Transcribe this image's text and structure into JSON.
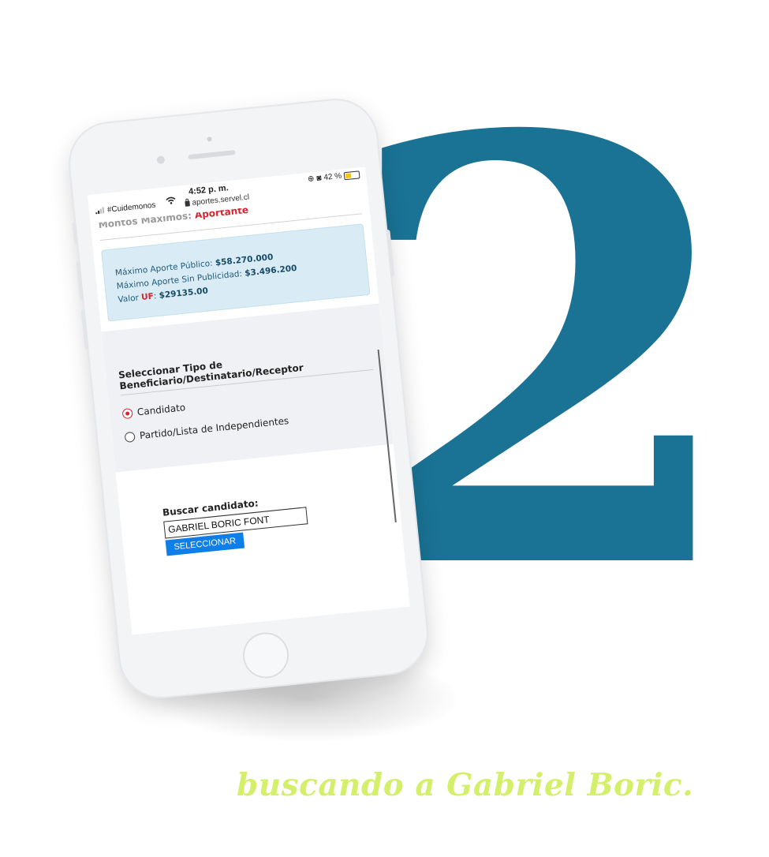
{
  "big_number": "2",
  "caption": "buscando a Gabriel Boric.",
  "colors": {
    "number": "#1a7395",
    "caption": "#d4f06a",
    "accent_red": "#d9232e",
    "button_blue": "#0e7ee8"
  },
  "status_bar": {
    "carrier": "#Cuidemonos",
    "time": "4:52 p. m.",
    "url": "aportes.servel.cl",
    "battery": "42 %",
    "battery_level": 0.42
  },
  "header_cut": {
    "text": "Montos Máximos: ",
    "highlight": "Aportante"
  },
  "info_box": {
    "public_label": "Máximo Aporte Público: ",
    "public_value": "$58.270.000",
    "nopub_label": "Máximo Aporte Sin Publicidad: ",
    "nopub_value": "$3.496.200",
    "uf_prefix": "Valor ",
    "uf_label": "UF",
    "uf_sep": ": ",
    "uf_value": "$29135.00"
  },
  "beneficiary": {
    "title": "Seleccionar Tipo de Beneficiario/Destinatario/Receptor",
    "options": [
      {
        "label": "Candidato",
        "selected": true
      },
      {
        "label": "Partido/Lista de Independientes",
        "selected": false
      }
    ]
  },
  "search": {
    "label": "Buscar candidato:",
    "value": "GABRIEL BORIC FONT",
    "button": "SELECCIONAR"
  }
}
